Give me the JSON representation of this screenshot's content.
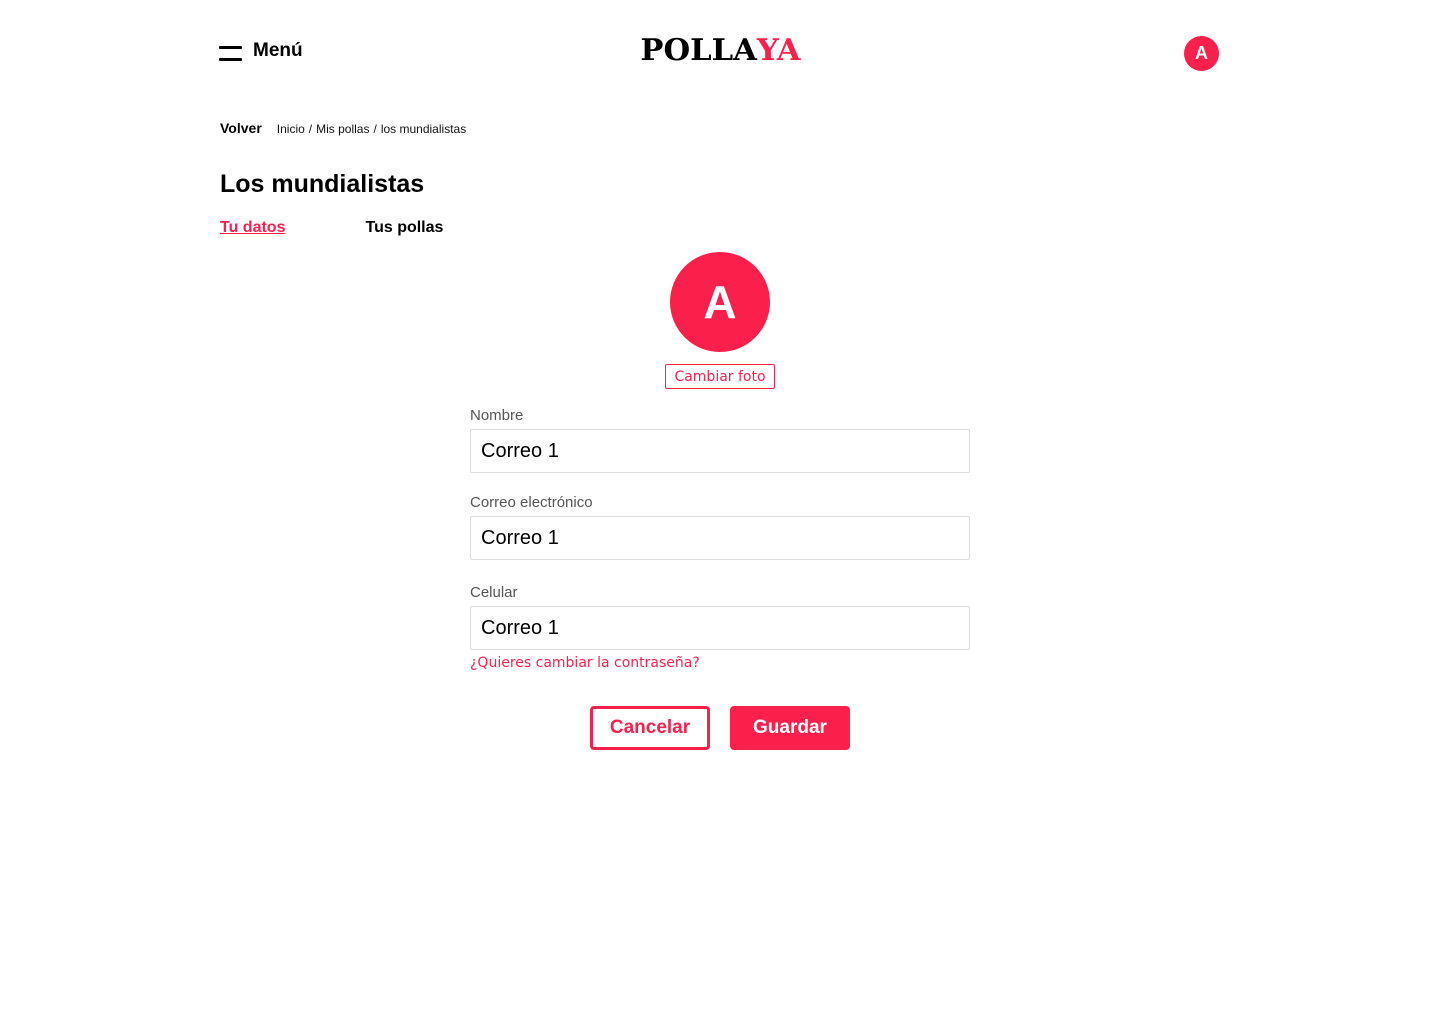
{
  "header": {
    "menu_label": "Menú",
    "menu_icon": "hamburger-icon",
    "logo_part1": "POLLA",
    "logo_part2": "YA",
    "user_initial": "A"
  },
  "breadcrumb": {
    "back_label": "Volver",
    "items": [
      "Inicio",
      "Mis pollas",
      "los mundialistas"
    ],
    "separator": "/"
  },
  "page": {
    "title": "Los mundialistas"
  },
  "tabs": [
    {
      "label": "Tu datos",
      "active": true
    },
    {
      "label": "Tus pollas",
      "active": false
    }
  ],
  "profile": {
    "initial": "A",
    "change_photo_label": "Cambiar foto"
  },
  "form": {
    "name_label": "Nombre",
    "name_value": "Correo 1",
    "email_label": "Correo electrónico",
    "email_value": "Correo 1",
    "phone_label": "Celular",
    "phone_value": "Correo 1",
    "change_password_link": "¿Quieres cambiar la contraseña?"
  },
  "actions": {
    "cancel_label": "Cancelar",
    "save_label": "Guardar"
  },
  "colors": {
    "accent": "#fb1f4c",
    "text": "#000000",
    "label": "#555555",
    "input_border": "#dcdcdc"
  }
}
